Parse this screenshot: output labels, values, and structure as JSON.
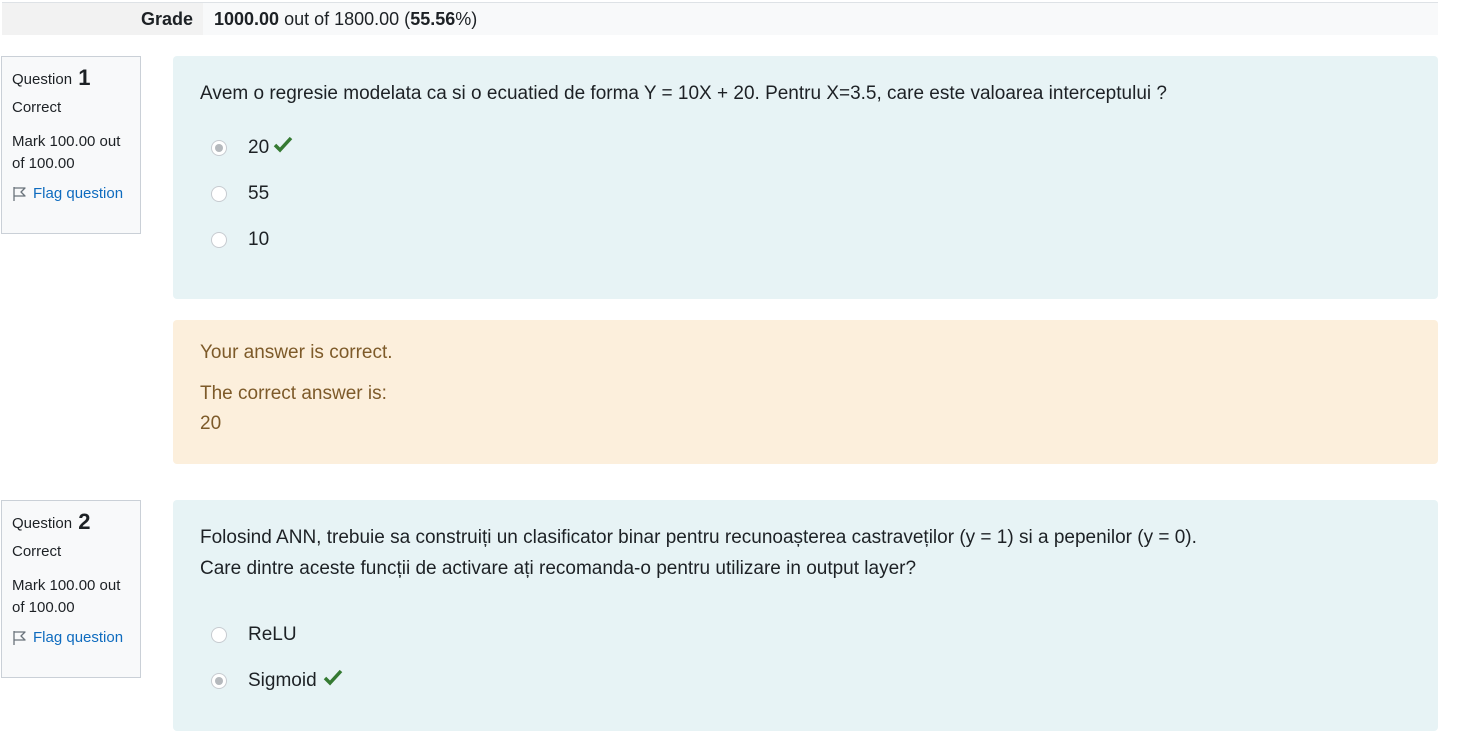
{
  "summary": {
    "grade_label": "Grade",
    "grade_value": "1000.00",
    "out_of_text": " out of 1800.00 (",
    "percent": "55.56",
    "percent_suffix": "%)"
  },
  "questions": [
    {
      "label": "Question",
      "number": "1",
      "state": "Correct",
      "mark": "Mark 100.00 out of 100.00",
      "flag_label": "Flag question",
      "text_lines": [
        "Avem o regresie modelata ca si o ecuatied de forma Y = 10X + 20. Pentru X=3.5, care este valoarea interceptului ?"
      ],
      "answers": [
        {
          "label": "20",
          "selected": true,
          "correct": true
        },
        {
          "label": "55",
          "selected": false,
          "correct": false
        },
        {
          "label": "10",
          "selected": false,
          "correct": false
        }
      ],
      "feedback": {
        "specific": "Your answer is correct.",
        "right_answer_label": "The correct answer is:",
        "right_answer_value": "20"
      }
    },
    {
      "label": "Question",
      "number": "2",
      "state": "Correct",
      "mark": "Mark 100.00 out of 100.00",
      "flag_label": "Flag question",
      "text_lines": [
        "Folosind ANN, trebuie sa construiți un clasificator binar pentru recunoașterea castraveților (y = 1) si a pepenilor (y = 0).",
        "Care dintre aceste funcții de activare ați recomanda-o pentru utilizare in output layer?"
      ],
      "answers": [
        {
          "label": "ReLU",
          "selected": false,
          "correct": false
        },
        {
          "label": "Sigmoid",
          "selected": true,
          "correct": true
        }
      ]
    }
  ],
  "icons": {
    "flag": "flag-icon",
    "correct": "check-icon"
  },
  "colors": {
    "question_bg": "#e7f3f5",
    "feedback_bg": "#fcefdc",
    "feedback_text": "#7d5a29",
    "correct_check": "#357a32",
    "link": "#0f6cbf"
  }
}
